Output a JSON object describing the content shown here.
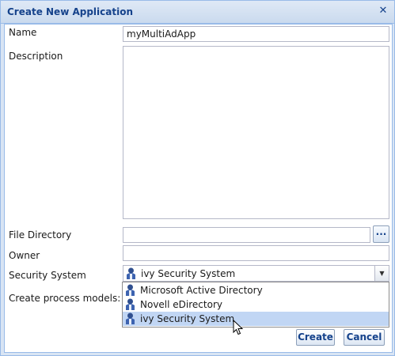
{
  "dialog": {
    "title": "Create New Application",
    "close_glyph": "✕"
  },
  "form": {
    "name_label": "Name",
    "name_value": "myMultiAdApp",
    "description_label": "Description",
    "description_value": "",
    "file_directory_label": "File Directory",
    "file_directory_value": "",
    "browse_label": "...",
    "owner_label": "Owner",
    "owner_value": "",
    "security_system_label": "Security System",
    "security_system_value": "ivy Security System",
    "create_process_models_label": "Create process models:"
  },
  "dropdown": {
    "options": [
      {
        "label": "Microsoft Active Directory",
        "icon": "directory-icon"
      },
      {
        "label": "Novell eDirectory",
        "icon": "directory-icon"
      },
      {
        "label": "ivy Security System",
        "icon": "directory-icon",
        "selected": true
      }
    ]
  },
  "buttons": {
    "create": "Create",
    "cancel": "Cancel"
  },
  "colors": {
    "title_text": "#15428b",
    "selected_option": "#c1d6f4",
    "window_border": "#99bbe8"
  }
}
